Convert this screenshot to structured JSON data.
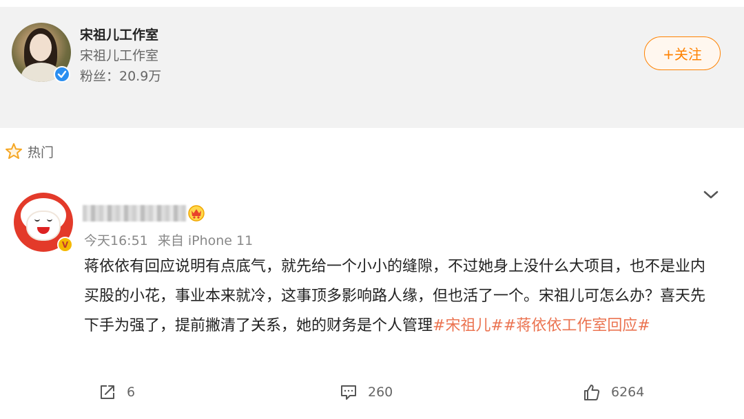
{
  "profile": {
    "name": "宋祖儿工作室",
    "subtitle": "宋祖儿工作室",
    "fans": "粉丝：20.9万",
    "follow_label": "+关注"
  },
  "section": {
    "label": "热门"
  },
  "post": {
    "time": "今天16:51",
    "source": "来自 iPhone 11",
    "text_plain": "蒋依依有回应说明有点底气，就先给一个小小的缝隙，不过她身上没什么大项目，也不是业内买股的小花，事业本来就冷，这事顶多影响路人缘，但也活了一个。宋祖儿可怎么办？喜天先下手为强了，提前撇清了关系，她的财务是个人管理",
    "tag1": "#宋祖儿#",
    "tag2": "#蒋依依工作室回应#"
  },
  "actions": {
    "repost_count": "6",
    "comment_count": "260",
    "like_count": "6264"
  },
  "colors": {
    "accent": "#ff8200",
    "tag": "#eb7350",
    "verify_blue": "#2b8ff0",
    "vip_gold": "#f5b800"
  }
}
